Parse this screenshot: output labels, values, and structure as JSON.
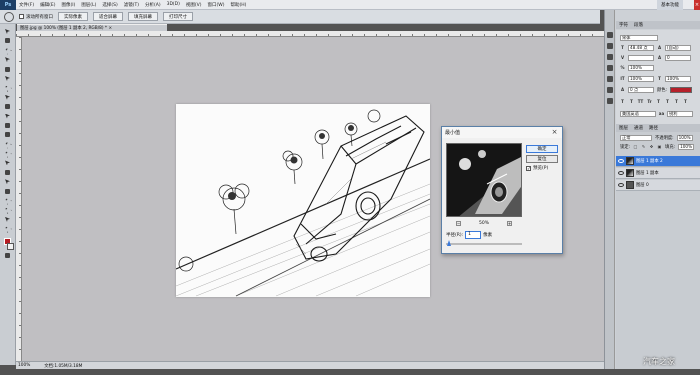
{
  "app": {
    "logo": "Ps"
  },
  "menu": {
    "items": [
      "文件(F)",
      "编辑(E)",
      "图像(I)",
      "图层(L)",
      "选择(S)",
      "滤镜(T)",
      "分析(A)",
      "3D(D)",
      "视图(V)",
      "窗口(W)",
      "帮助(H)"
    ]
  },
  "header_right": {
    "workspace": "基本功能"
  },
  "options": {
    "check_label": "滚动所有窗口",
    "buttons": [
      "实际像素",
      "适合屏幕",
      "填充屏幕",
      "打印尺寸"
    ]
  },
  "document": {
    "tab_label": "图层.jpg @ 100% (图层 1 副本 2, RGB/8) * ×"
  },
  "status": {
    "zoom": "100%",
    "doc_size": "文档:1.05M/3.18M"
  },
  "character_panel": {
    "tabs": [
      "字符",
      "段落"
    ],
    "font": "宋体",
    "size": "48.48 点",
    "leading": "(自动)",
    "tracking": "0",
    "scale_v": "100%",
    "scale_h": "100%",
    "baseline": "0 点",
    "color_label": "颜色:",
    "style_buttons": [
      "T",
      "T",
      "TT",
      "Tr",
      "T",
      "T",
      "T",
      "T"
    ],
    "language": "美国英语",
    "aa": "锐利",
    "color": "#b5202a"
  },
  "layers_panel": {
    "tabs": [
      "图层",
      "通道",
      "路径"
    ],
    "blend_mode": "正常",
    "opacity_label": "不透明度:",
    "opacity": "100%",
    "lock_label": "锁定:",
    "fill_label": "填充:",
    "fill": "100%",
    "layers": [
      {
        "name": "图层 1 副本 2",
        "active": true
      },
      {
        "name": "图层 1 副本",
        "active": false
      },
      {
        "name": "图层 0",
        "active": false
      }
    ]
  },
  "dialog": {
    "title": "最小值",
    "ok": "确定",
    "reset": "复位",
    "preview_label": "预览(P)",
    "zoom": "50%",
    "zoom_minus": "−",
    "zoom_plus": "+",
    "radius_label": "半径(R):",
    "radius_value": "1",
    "radius_unit": "像素"
  },
  "watermark": "汽车之家"
}
